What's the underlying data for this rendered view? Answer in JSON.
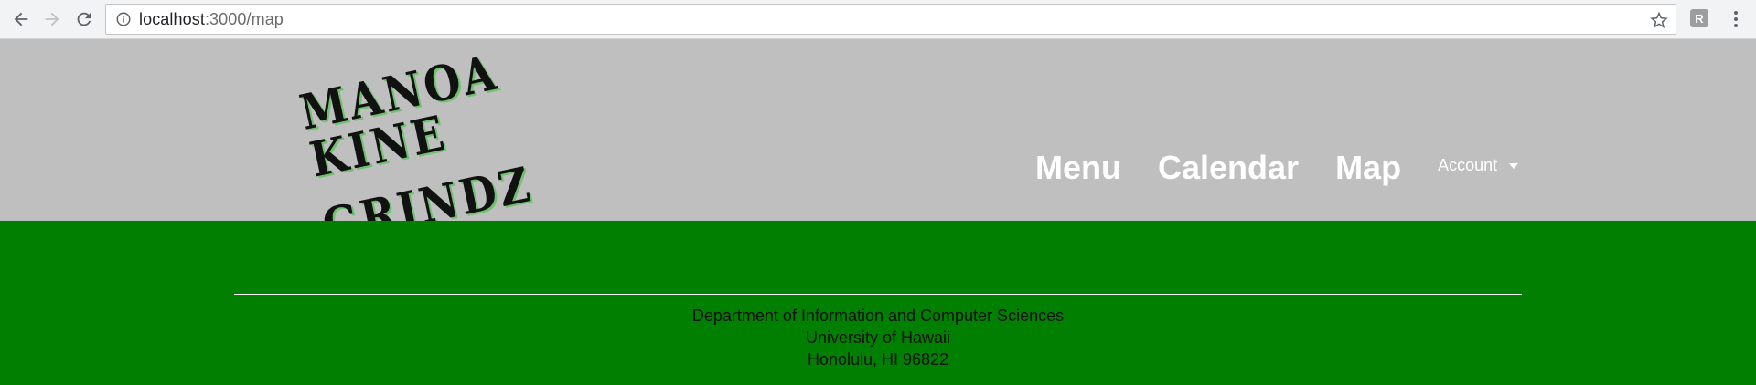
{
  "browser": {
    "url_host": "localhost",
    "url_path": ":3000/map",
    "extension_label": "R",
    "icons": {
      "back": "arrow-left-icon",
      "forward": "arrow-right-icon",
      "reload": "reload-icon",
      "info": "info-icon",
      "bookmark": "star-icon",
      "menu": "kebab-icon"
    }
  },
  "header": {
    "logo_line1": "MANOA KINE",
    "logo_line2": "GRINDZ",
    "nav": {
      "menu": "Menu",
      "calendar": "Calendar",
      "map": "Map",
      "account": "Account"
    },
    "background_color": "#bfbfbf"
  },
  "footer": {
    "line1": "Department of Information and Computer Sciences",
    "line2": "University of Hawaii",
    "line3": "Honolulu, HI 96822",
    "background_color": "#007f00"
  }
}
